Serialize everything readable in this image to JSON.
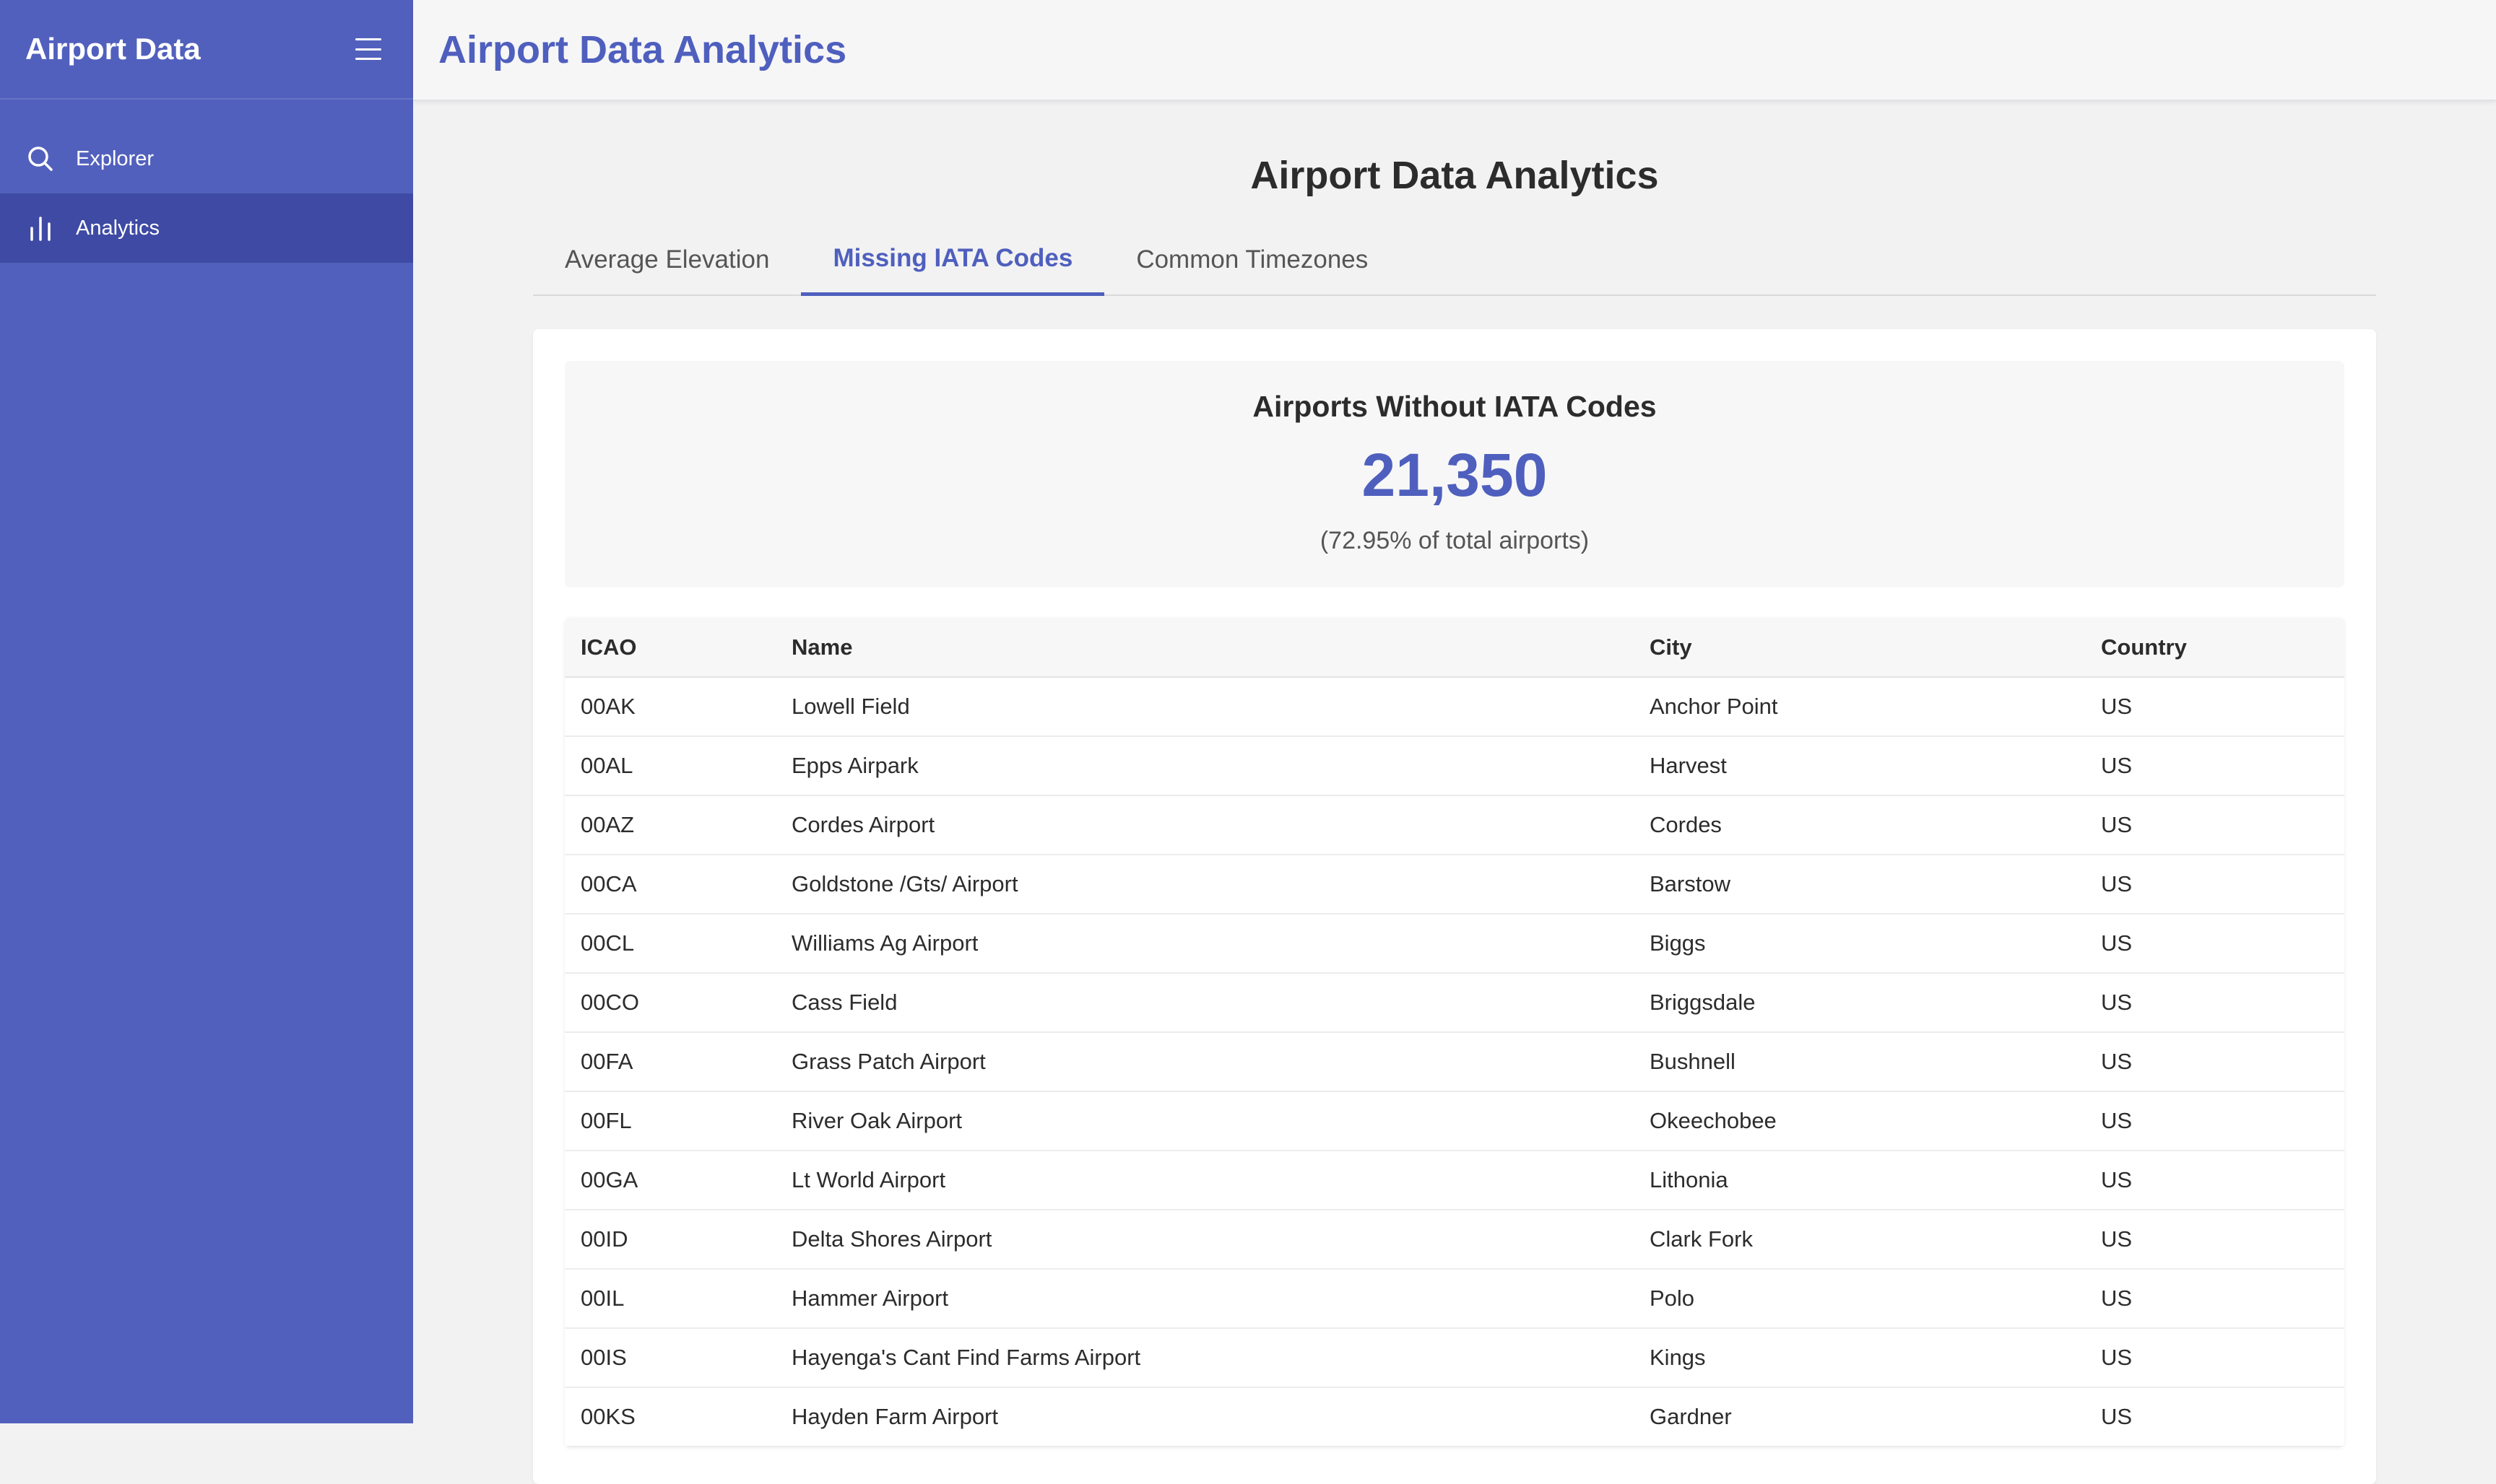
{
  "sidebar": {
    "title": "Airport Data",
    "items": [
      {
        "label": "Explorer",
        "icon": "search-icon"
      },
      {
        "label": "Analytics",
        "icon": "bar-chart-icon"
      }
    ]
  },
  "header": {
    "title": "Airport Data Analytics"
  },
  "main": {
    "title": "Airport Data Analytics",
    "tabs": [
      {
        "label": "Average Elevation"
      },
      {
        "label": "Missing IATA Codes"
      },
      {
        "label": "Common Timezones"
      }
    ],
    "active_tab": "Missing IATA Codes",
    "stat": {
      "heading": "Airports Without IATA Codes",
      "value": "21,350",
      "subtext": "(72.95% of total airports)"
    },
    "table": {
      "columns": [
        "ICAO",
        "Name",
        "City",
        "Country"
      ],
      "rows": [
        [
          "00AK",
          "Lowell Field",
          "Anchor Point",
          "US"
        ],
        [
          "00AL",
          "Epps Airpark",
          "Harvest",
          "US"
        ],
        [
          "00AZ",
          "Cordes Airport",
          "Cordes",
          "US"
        ],
        [
          "00CA",
          "Goldstone /Gts/ Airport",
          "Barstow",
          "US"
        ],
        [
          "00CL",
          "Williams Ag Airport",
          "Biggs",
          "US"
        ],
        [
          "00CO",
          "Cass Field",
          "Briggsdale",
          "US"
        ],
        [
          "00FA",
          "Grass Patch Airport",
          "Bushnell",
          "US"
        ],
        [
          "00FL",
          "River Oak Airport",
          "Okeechobee",
          "US"
        ],
        [
          "00GA",
          "Lt World Airport",
          "Lithonia",
          "US"
        ],
        [
          "00ID",
          "Delta Shores Airport",
          "Clark Fork",
          "US"
        ],
        [
          "00IL",
          "Hammer Airport",
          "Polo",
          "US"
        ],
        [
          "00IS",
          "Hayenga's Cant Find Farms Airport",
          "Kings",
          "US"
        ],
        [
          "00KS",
          "Hayden Farm Airport",
          "Gardner",
          "US"
        ]
      ]
    }
  },
  "colors": {
    "sidebar_bg": "#5260bd",
    "sidebar_active": "#3e4aa3",
    "accent": "#4f5fbe"
  }
}
